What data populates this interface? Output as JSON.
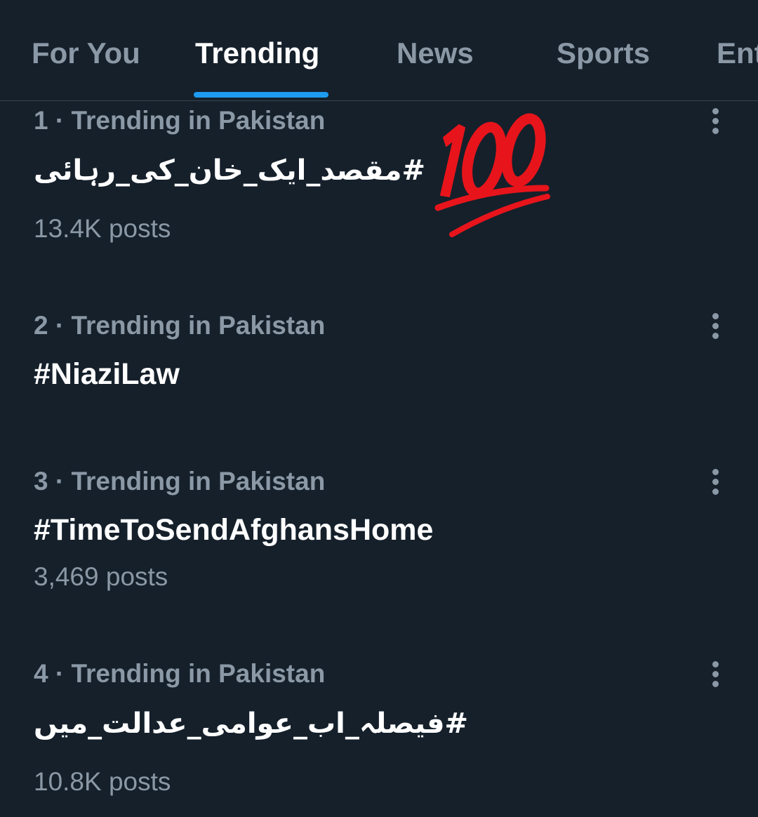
{
  "tabs": [
    {
      "label": "For You",
      "active": false
    },
    {
      "label": "Trending",
      "active": true
    },
    {
      "label": "News",
      "active": false
    },
    {
      "label": "Sports",
      "active": false
    },
    {
      "label": "Ent",
      "active": false
    }
  ],
  "trends": [
    {
      "meta": "1 · Trending in Pakistan",
      "name": "#مقصد_ایک_خان_کی_رہائی",
      "posts": "13.4K posts"
    },
    {
      "meta": "2 · Trending in Pakistan",
      "name": "#NiaziLaw",
      "posts": ""
    },
    {
      "meta": "3 · Trending in Pakistan",
      "name": "#TimeToSendAfghansHome",
      "posts": "3,469 posts"
    },
    {
      "meta": "4 · Trending in Pakistan",
      "name": "#فیصلہ_اب_عوامی_عدالت_میں",
      "posts": "10.8K posts"
    }
  ],
  "icons": {
    "more": "more-vertical-icon",
    "emoji": "hundred-points-emoji"
  },
  "colors": {
    "background": "#15202b",
    "accent": "#1d9bf0",
    "secondary_text": "#8b98a5",
    "primary_text": "#ffffff",
    "emoji_red": "#e8141b"
  }
}
